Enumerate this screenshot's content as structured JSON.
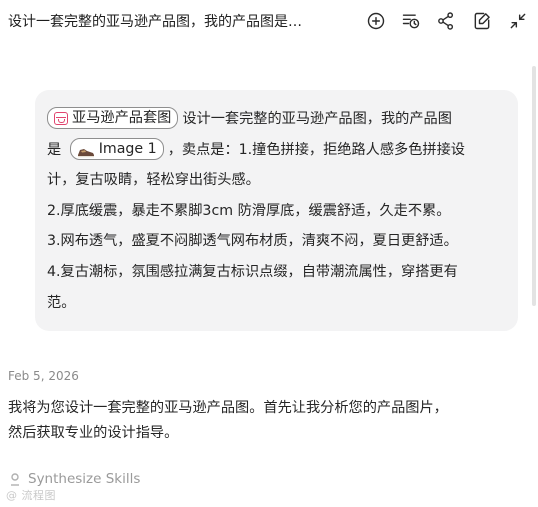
{
  "header": {
    "title": "设计一套完整的亚马逊产品图，我的产品图是…",
    "icons": [
      "add-circle-icon",
      "history-list-icon",
      "share-icon",
      "edit-note-icon",
      "collapse-icon"
    ]
  },
  "user_message": {
    "skill_chip_label": "亚马逊产品套图",
    "line1_after_chip": "设计一套完整的亚马逊产品图，我的产品图",
    "line2_before_chip": "是",
    "image_chip_label": "Image 1",
    "line2_after_chip": "，卖点是：1.撞色拼接，拒绝路人感多色拼接设",
    "line3": "计，复古吸睛，轻松穿出街头感。",
    "line4": "2.厚底缓震，暴走不累脚3cm 防滑厚底，缓震舒适，久走不累。",
    "line5": "3.网布透气，盛夏不闷脚透气网布材质，清爽不闷，夏日更舒适。",
    "line6": "4.复古潮标，氛围感拉满复古标识点缀，自带潮流属性，穿搭更有",
    "line7": "范。"
  },
  "assistant": {
    "date": "Feb 5, 2026",
    "reply_line1": "我将为您设计一套完整的亚马逊产品图。首先让我分析您的产品图片，",
    "reply_line2": "然后获取专业的设计指导。",
    "skills_label": "Synthesize Skills",
    "watermark": "@ 流程图"
  }
}
